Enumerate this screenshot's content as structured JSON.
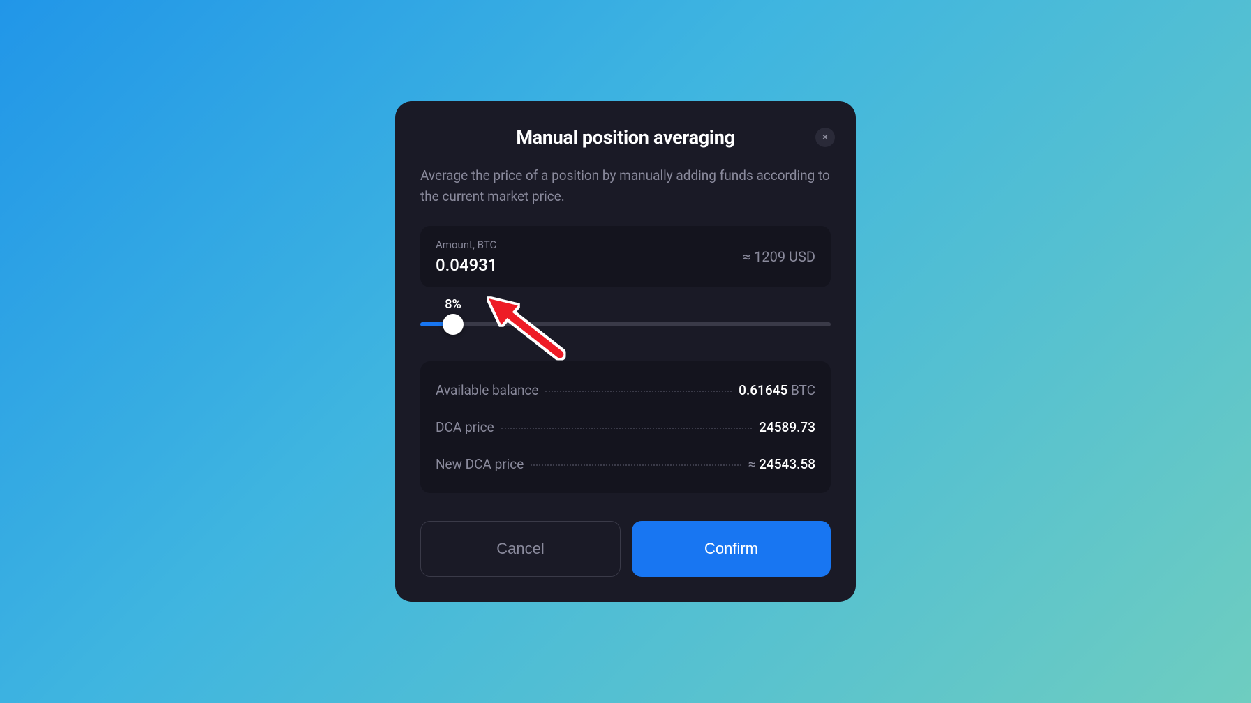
{
  "modal": {
    "title": "Manual position averaging",
    "description": "Average the price of a position by manually adding funds according to the current market price.",
    "close_icon": "×"
  },
  "amount": {
    "label": "Amount, BTC",
    "value": "0.04931",
    "usd": "≈ 1209 USD"
  },
  "slider": {
    "percent": "8%",
    "percent_value": 8
  },
  "info": {
    "rows": [
      {
        "label": "Available balance",
        "value": "0.61645",
        "unit": " BTC",
        "approx": ""
      },
      {
        "label": "DCA price",
        "value": "24589.73",
        "unit": "",
        "approx": ""
      },
      {
        "label": "New DCA price",
        "value": "24543.58",
        "unit": "",
        "approx": "≈ "
      }
    ]
  },
  "buttons": {
    "cancel": "Cancel",
    "confirm": "Confirm"
  }
}
